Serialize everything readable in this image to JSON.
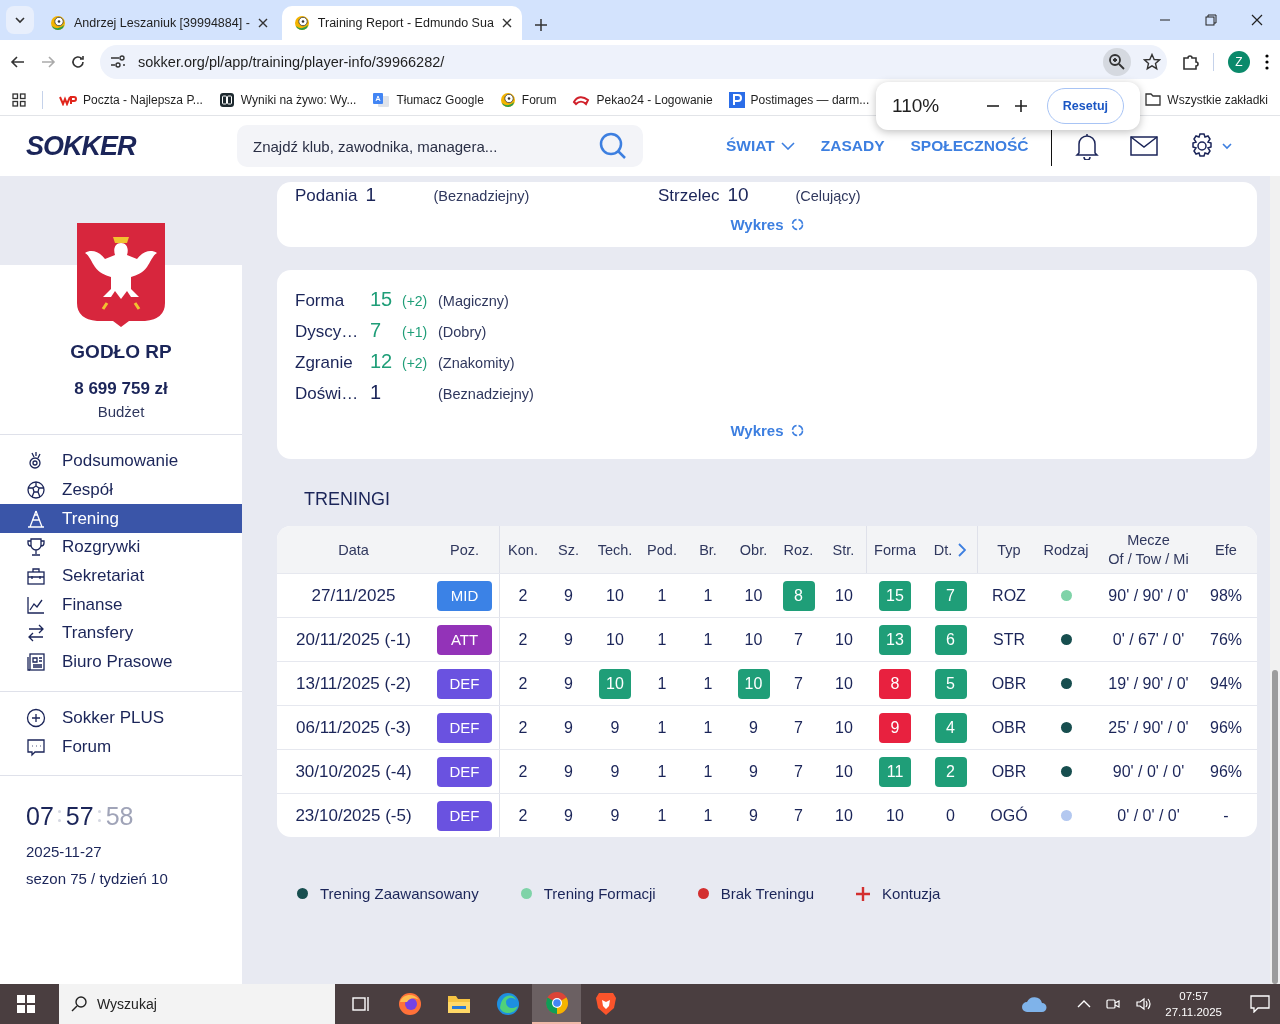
{
  "browser": {
    "tabs": [
      {
        "title": "Andrzej Leszaniuk [39994884] -",
        "selected": false
      },
      {
        "title": "Training Report - Edmundo Sua",
        "selected": true
      }
    ],
    "url": "sokker.org/pl/app/training/player-info/39966282/",
    "profile_initial": "Z",
    "bookmarks": [
      {
        "label": "Poczta - Najlepsza P..."
      },
      {
        "label": "Wyniki na żywo: Wy..."
      },
      {
        "label": "Tłumacz Google"
      },
      {
        "label": "Forum"
      },
      {
        "label": "Pekao24 - Logowanie"
      },
      {
        "label": "Postimages — darm..."
      }
    ],
    "all_bookmarks": "Wszystkie zakładki",
    "zoom_popup": {
      "value": "110%",
      "reset": "Resetuj"
    }
  },
  "header": {
    "logo": "SOKKER",
    "search_placeholder": "Znajdź klub, zawodnika, managera...",
    "nav": [
      {
        "label": "ŚWIAT",
        "dropdown": true
      },
      {
        "label": "ZASADY",
        "dropdown": false
      },
      {
        "label": "SPOŁECZNOŚĆ",
        "dropdown": false
      }
    ]
  },
  "sidebar": {
    "club": "GODŁO RP",
    "budget": "8 699 759 zł",
    "budget_label": "Budżet",
    "menu": [
      {
        "label": "Podsumowanie",
        "selected": false
      },
      {
        "label": "Zespół",
        "selected": false
      },
      {
        "label": "Trening",
        "selected": true
      },
      {
        "label": "Rozgrywki",
        "selected": false
      },
      {
        "label": "Sekretariat",
        "selected": false
      },
      {
        "label": "Finanse",
        "selected": false
      },
      {
        "label": "Transfery",
        "selected": false
      },
      {
        "label": "Biuro Prasowe",
        "selected": false
      }
    ],
    "extra_menu": [
      {
        "label": "Sokker PLUS"
      },
      {
        "label": "Forum"
      }
    ],
    "clock": [
      "07",
      "57",
      "58"
    ],
    "date": "2025-11-27",
    "season": "sezon 75 / tydzień 10"
  },
  "skills_card": {
    "rows": [
      {
        "skill": "Podania",
        "value": "1",
        "rating": "(Beznadziejny)"
      },
      {
        "skill": "Strzelec",
        "value": "10",
        "rating": "(Celujący)"
      }
    ],
    "chart_link": "Wykres"
  },
  "form_card": {
    "rows": [
      {
        "name": "Forma",
        "value": "15",
        "change": "(+2)",
        "label": "(Magiczny)"
      },
      {
        "name": "Dyscy…",
        "value": "7",
        "change": "(+1)",
        "label": "(Dobry)"
      },
      {
        "name": "Zgranie",
        "value": "12",
        "change": "(+2)",
        "label": "(Znakomity)"
      },
      {
        "name": "Doświ…",
        "value": "1",
        "label": "(Beznadziejny)"
      }
    ],
    "chart_link": "Wykres"
  },
  "trainings": {
    "title": "TRENINGI",
    "columns": [
      {
        "label": "Data"
      },
      {
        "label": "Poz."
      },
      {
        "label": "Kon."
      },
      {
        "label": "Sz."
      },
      {
        "label": "Tech."
      },
      {
        "label": "Pod."
      },
      {
        "label": "Br."
      },
      {
        "label": "Obr."
      },
      {
        "label": "Roz."
      },
      {
        "label": "Str."
      },
      {
        "label": "Forma"
      },
      {
        "label": "Dt.",
        "scroll_arrow": true
      },
      {
        "label": "Typ"
      },
      {
        "label": "Rodzaj"
      },
      {
        "label": "Mecze",
        "sublabel": "Of / Tow / Mi"
      },
      {
        "label": "Efe"
      }
    ],
    "rows": [
      {
        "date": "27/11/2025",
        "position": {
          "label": "MID",
          "color": "#3b82e6"
        },
        "skills": [
          "2",
          "9",
          "10",
          "1",
          "1",
          "10",
          {
            "text": "8",
            "color": "#1f9e78"
          },
          "10",
          {
            "text": "15",
            "color": "#1f9e78"
          },
          {
            "text": "7",
            "color": "#1f9e78"
          }
        ],
        "type": "ROZ",
        "kind_dot": {
          "color": "#7fd3a8"
        },
        "matches": "90' / 90' / 0'",
        "efficiency": "98%"
      },
      {
        "date": "20/11/2025 (-1)",
        "position": {
          "label": "ATT",
          "color": "#9333b8"
        },
        "skills": [
          "2",
          "9",
          "10",
          "1",
          "1",
          "10",
          "7",
          "10",
          {
            "text": "13",
            "color": "#1f9e78"
          },
          {
            "text": "6",
            "color": "#1f9e78"
          }
        ],
        "type": "STR",
        "kind_dot": {
          "color": "#174e4f"
        },
        "matches": "0' / 67' / 0'",
        "efficiency": "76%"
      },
      {
        "date": "13/11/2025 (-2)",
        "position": {
          "label": "DEF",
          "color": "#6a52e0"
        },
        "skills": [
          "2",
          "9",
          {
            "text": "10",
            "color": "#1f9e78"
          },
          "1",
          "1",
          {
            "text": "10",
            "color": "#1f9e78"
          },
          "7",
          "10",
          {
            "text": "8",
            "color": "#e8213f"
          },
          {
            "text": "5",
            "color": "#1f9e78"
          }
        ],
        "type": "OBR",
        "kind_dot": {
          "color": "#174e4f"
        },
        "matches": "19' / 90' / 0'",
        "efficiency": "94%"
      },
      {
        "date": "06/11/2025 (-3)",
        "position": {
          "label": "DEF",
          "color": "#6a52e0"
        },
        "skills": [
          "2",
          "9",
          "9",
          "1",
          "1",
          "9",
          "7",
          "10",
          {
            "text": "9",
            "color": "#e8213f"
          },
          {
            "text": "4",
            "color": "#1f9e78"
          }
        ],
        "type": "OBR",
        "kind_dot": {
          "color": "#174e4f"
        },
        "matches": "25' / 90' / 0'",
        "efficiency": "96%"
      },
      {
        "date": "30/10/2025 (-4)",
        "position": {
          "label": "DEF",
          "color": "#6a52e0"
        },
        "skills": [
          "2",
          "9",
          "9",
          "1",
          "1",
          "9",
          "7",
          "10",
          {
            "text": "11",
            "color": "#1f9e78"
          },
          {
            "text": "2",
            "color": "#1f9e78"
          }
        ],
        "type": "OBR",
        "kind_dot": {
          "color": "#174e4f"
        },
        "matches": "90' / 0' / 0'",
        "efficiency": "96%"
      },
      {
        "date": "23/10/2025 (-5)",
        "position": {
          "label": "DEF",
          "color": "#6a52e0"
        },
        "skills": [
          "2",
          "9",
          "9",
          "1",
          "1",
          "9",
          "7",
          "10",
          "10",
          "0"
        ],
        "type": "OGÓ",
        "kind_dot": {
          "color": "#b3c8f0"
        },
        "matches": "0' / 0' / 0'",
        "efficiency": "-"
      }
    ]
  },
  "legend": [
    {
      "label": "Trening Zaawansowany",
      "kind": "dot",
      "color": "#174e4f"
    },
    {
      "label": "Trening Formacji",
      "kind": "dot",
      "color": "#7fd3a8"
    },
    {
      "label": "Brak Treningu",
      "kind": "dot",
      "color": "#d32f2f"
    },
    {
      "label": "Kontuzja",
      "kind": "cross",
      "color": "#d32f2f"
    }
  ],
  "taskbar": {
    "search_placeholder": "Wyszukaj",
    "time": "07:57",
    "date": "27.11.2025"
  }
}
